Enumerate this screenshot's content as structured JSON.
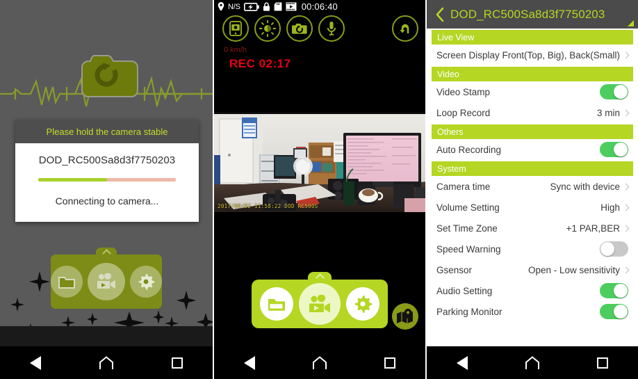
{
  "panel_connect": {
    "name": "connecting-screen",
    "logo_icon": "camera-refresh-icon",
    "dialog": {
      "title": "Please hold the camera stable",
      "device_name": "DOD_RC500Sa8d3f7750203",
      "progress_percent": 50,
      "progress_fill_color": "#a8d12a",
      "progress_track_color": "#f0b8a8",
      "status": "Connecting to camera..."
    },
    "dock": {
      "items": [
        {
          "icon": "folder-icon",
          "label": "Files"
        },
        {
          "icon": "video-camera-icon",
          "label": "Live View"
        },
        {
          "icon": "gear-icon",
          "label": "Settings"
        }
      ],
      "handle_icon": "chevron-up-icon"
    }
  },
  "panel_live": {
    "name": "live-view-screen",
    "status_bar": {
      "gps_icon": "location-pin-icon",
      "gps_text": "N/S",
      "battery_icon": "battery-charging-icon",
      "lock_icon": "lock-icon",
      "sdcard_icon": "sd-card-icon",
      "film_icon": "film-strip-icon",
      "clock": "00:06:40"
    },
    "tools": [
      {
        "icon": "phone-snapshot-icon",
        "label": "Snapshot to phone"
      },
      {
        "icon": "brightness-icon",
        "label": "Brightness"
      },
      {
        "icon": "camera-switch-icon",
        "label": "Switch camera"
      },
      {
        "icon": "microphone-icon",
        "label": "Microphone"
      }
    ],
    "return_button": {
      "icon": "return-arrow-icon",
      "label": "Back"
    },
    "speed": "0 km/h",
    "speed_color": "#8c1414",
    "rec_text": "REC 02:17",
    "rec_color": "#e60012",
    "video_stamp": "2017/08/02 11:58:22 DOD RC500S",
    "dock": {
      "items": [
        {
          "icon": "folder-icon",
          "label": "Files"
        },
        {
          "icon": "video-camera-icon",
          "label": "Recording"
        },
        {
          "icon": "gear-icon",
          "label": "Settings"
        }
      ],
      "handle_icon": "chevron-up-icon"
    },
    "gps_badge_icon": "gps-map-pin-icon"
  },
  "panel_settings": {
    "name": "settings-screen",
    "header": {
      "back_icon": "chevron-left-icon",
      "title": "DOD_RC500Sa8d3f7750203",
      "signal_icon": "signal-triangle-icon",
      "accent_color": "#b5d623"
    },
    "sections": [
      {
        "title": "Live View",
        "rows": [
          {
            "label": "Screen Display",
            "type": "value",
            "value": "Front(Top, Big), Back(Small)"
          }
        ]
      },
      {
        "title": "Video",
        "rows": [
          {
            "label": "Video Stamp",
            "type": "toggle",
            "value": "on"
          },
          {
            "label": "Loop Record",
            "type": "value",
            "value": "3 min"
          }
        ]
      },
      {
        "title": "Others",
        "rows": [
          {
            "label": "Auto Recording",
            "type": "toggle",
            "value": "on"
          }
        ]
      },
      {
        "title": "System",
        "rows": [
          {
            "label": "Camera time",
            "type": "value",
            "value": "Sync with device"
          },
          {
            "label": "Volume Setting",
            "type": "value",
            "value": "High"
          },
          {
            "label": "Set Time Zone",
            "type": "value",
            "value": "+1 PAR,BER"
          },
          {
            "label": "Speed Warning",
            "type": "toggle",
            "value": "off"
          },
          {
            "label": "Gsensor",
            "type": "value",
            "value": "Open - Low sensitivity"
          },
          {
            "label": "Audio Setting",
            "type": "toggle",
            "value": "on"
          },
          {
            "label": "Parking Monitor",
            "type": "toggle",
            "value": "on"
          }
        ]
      }
    ]
  },
  "navbar": {
    "back": "back-button",
    "home": "home-button",
    "recents": "recents-button"
  }
}
